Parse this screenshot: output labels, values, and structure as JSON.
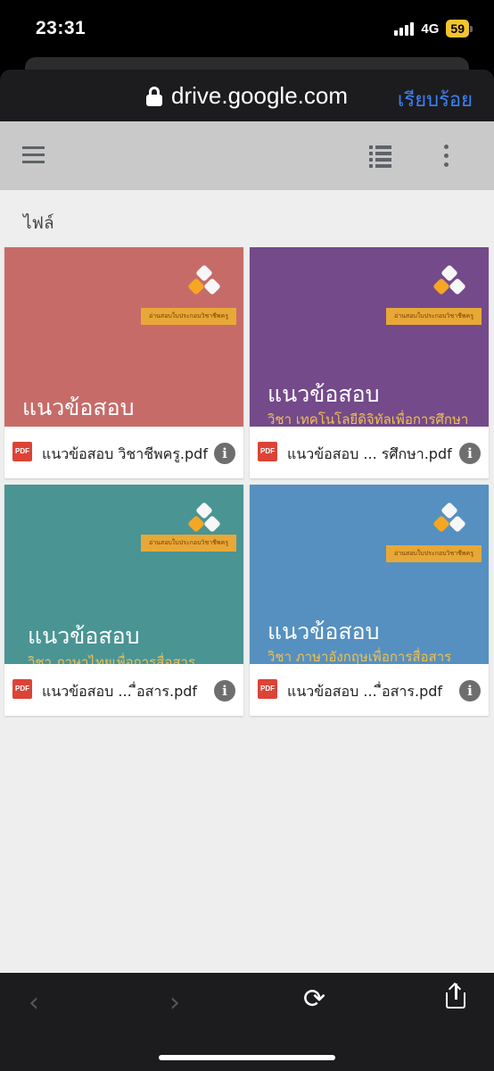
{
  "status": {
    "time": "23:31",
    "network": "4G",
    "battery": "59"
  },
  "browser": {
    "host": "drive.google.com",
    "done_label": "เรียบร้อย"
  },
  "drive": {
    "section_label": "ไฟล์",
    "files": [
      {
        "thumb_title": "แนวข้อสอบ",
        "thumb_subtitle": "",
        "tag": "อ่านสอบใบประกอบวิชาชีพครู",
        "name": "แนวข้อสอบ วิชาชีพครู.pdf",
        "bg": "#c76b68"
      },
      {
        "thumb_title": "แนวข้อสอบ",
        "thumb_subtitle": "วิชา เทคโนโลยีดิจิทัลเพื่อการศึกษา",
        "tag": "อ่านสอบใบประกอบวิชาชีพครู",
        "name": "แนวข้อสอบ ... รศึกษา.pdf",
        "bg": "#744a8a"
      },
      {
        "thumb_title": "แนวข้อสอบ",
        "thumb_subtitle": "วิชา ภาษาไทยเพื่อการสื่อสาร",
        "tag": "อ่านสอบใบประกอบวิชาชีพครู",
        "name": "แนวข้อสอบ ... ื่อสาร.pdf",
        "bg": "#4a9494"
      },
      {
        "thumb_title": "แนวข้อสอบ",
        "thumb_subtitle": "วิชา ภาษาอังกฤษเพื่อการสื่อสาร",
        "tag": "อ่านสอบใบประกอบวิชาชีพครู",
        "name": "แนวข้อสอบ ... ื่อสาร.pdf",
        "bg": "#5590c0"
      }
    ]
  },
  "icons": {
    "pdf": "PDF",
    "info": "i",
    "back": "‹",
    "forward": "›",
    "reload": "⟳"
  },
  "colors": {
    "accent": "#3b82f6",
    "pdf_red": "#db4437",
    "tag_orange": "#e8a838",
    "subtitle_yellow": "#f0c050"
  }
}
